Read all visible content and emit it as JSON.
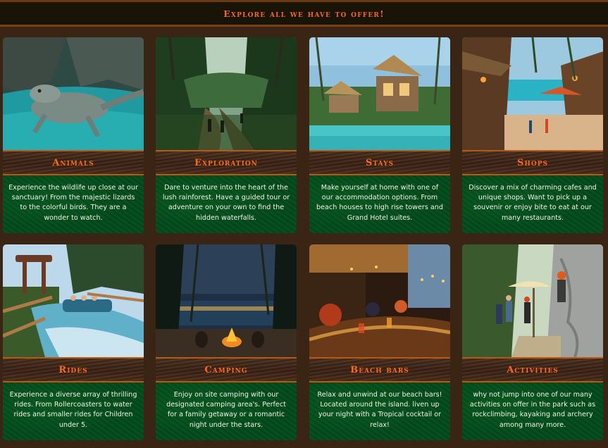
{
  "header": {
    "title": "Explore all we have to offer!"
  },
  "cards": [
    {
      "title": "Animals",
      "text": "Experience the wildlife up close at our sanctuary! From the majestic lizards to the colorful birds. They are a wonder to watch."
    },
    {
      "title": "Exploration",
      "text": "Dare to venture into the heart of the lush rainforest. Have a guided tour or adventure on your own to find the hidden waterfalls."
    },
    {
      "title": "Stays",
      "text": "Make yourself at home with one of our accommodation options. From beach houses to high rise towers and Grand Hotel suites."
    },
    {
      "title": "Shops",
      "text": "Discover a mix of charming cafes and unique shops. Want to pick up a souvenir or enjoy bite to eat at our many restaurants."
    },
    {
      "title": "Rides",
      "text": "Experience a diverse array of thrilling rides. From Rollercoasters to water rides and smaller rides for Children under 5."
    },
    {
      "title": "Camping",
      "text": "Enjoy on site camping with our designated camping area's. Perfect for a family getaway or a romantic night under the stars."
    },
    {
      "title": "Beach bars",
      "text": "Relax and unwind at our beach bars! Located around the island. liven up your night with a Tropical cocktail or relax!"
    },
    {
      "title": "Activities",
      "text": "why not jump into one of our many activities on offer in the park such as rockclimbing, kayaking and archery among many more."
    }
  ],
  "colors": {
    "accent": "#ff6a1a",
    "background": "#3a2413",
    "panel": "#05501e"
  }
}
